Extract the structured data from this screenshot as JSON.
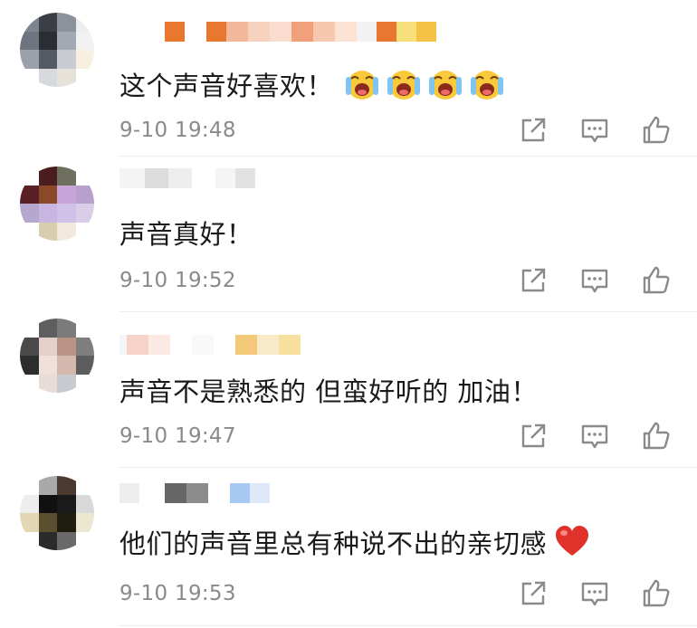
{
  "comments": [
    {
      "text": "这个声音好喜欢！",
      "time": "9-10 19:48",
      "emoji": [
        "grinning-tears-emoji",
        "grinning-tears-emoji",
        "grinning-tears-emoji",
        "grinning-tears-emoji"
      ]
    },
    {
      "text": "声音真好！",
      "time": "9-10 19:52",
      "emoji": []
    },
    {
      "text": "声音不是熟悉的 但蛮好听的 加油！",
      "time": "9-10 19:47",
      "emoji": []
    },
    {
      "text": "他们的声音里总有种说不出的亲切感",
      "time": "9-10 19:53",
      "emoji": [
        "red-heart-emoji"
      ]
    }
  ],
  "actions": {
    "share": "share-icon",
    "reply": "comment-icon",
    "like": "thumbs-up-icon"
  },
  "colors": {
    "text": "#1a1a1a",
    "timestamp": "#8a8a8a",
    "icon": "#8a8a8a",
    "heart": "#e0322b"
  }
}
